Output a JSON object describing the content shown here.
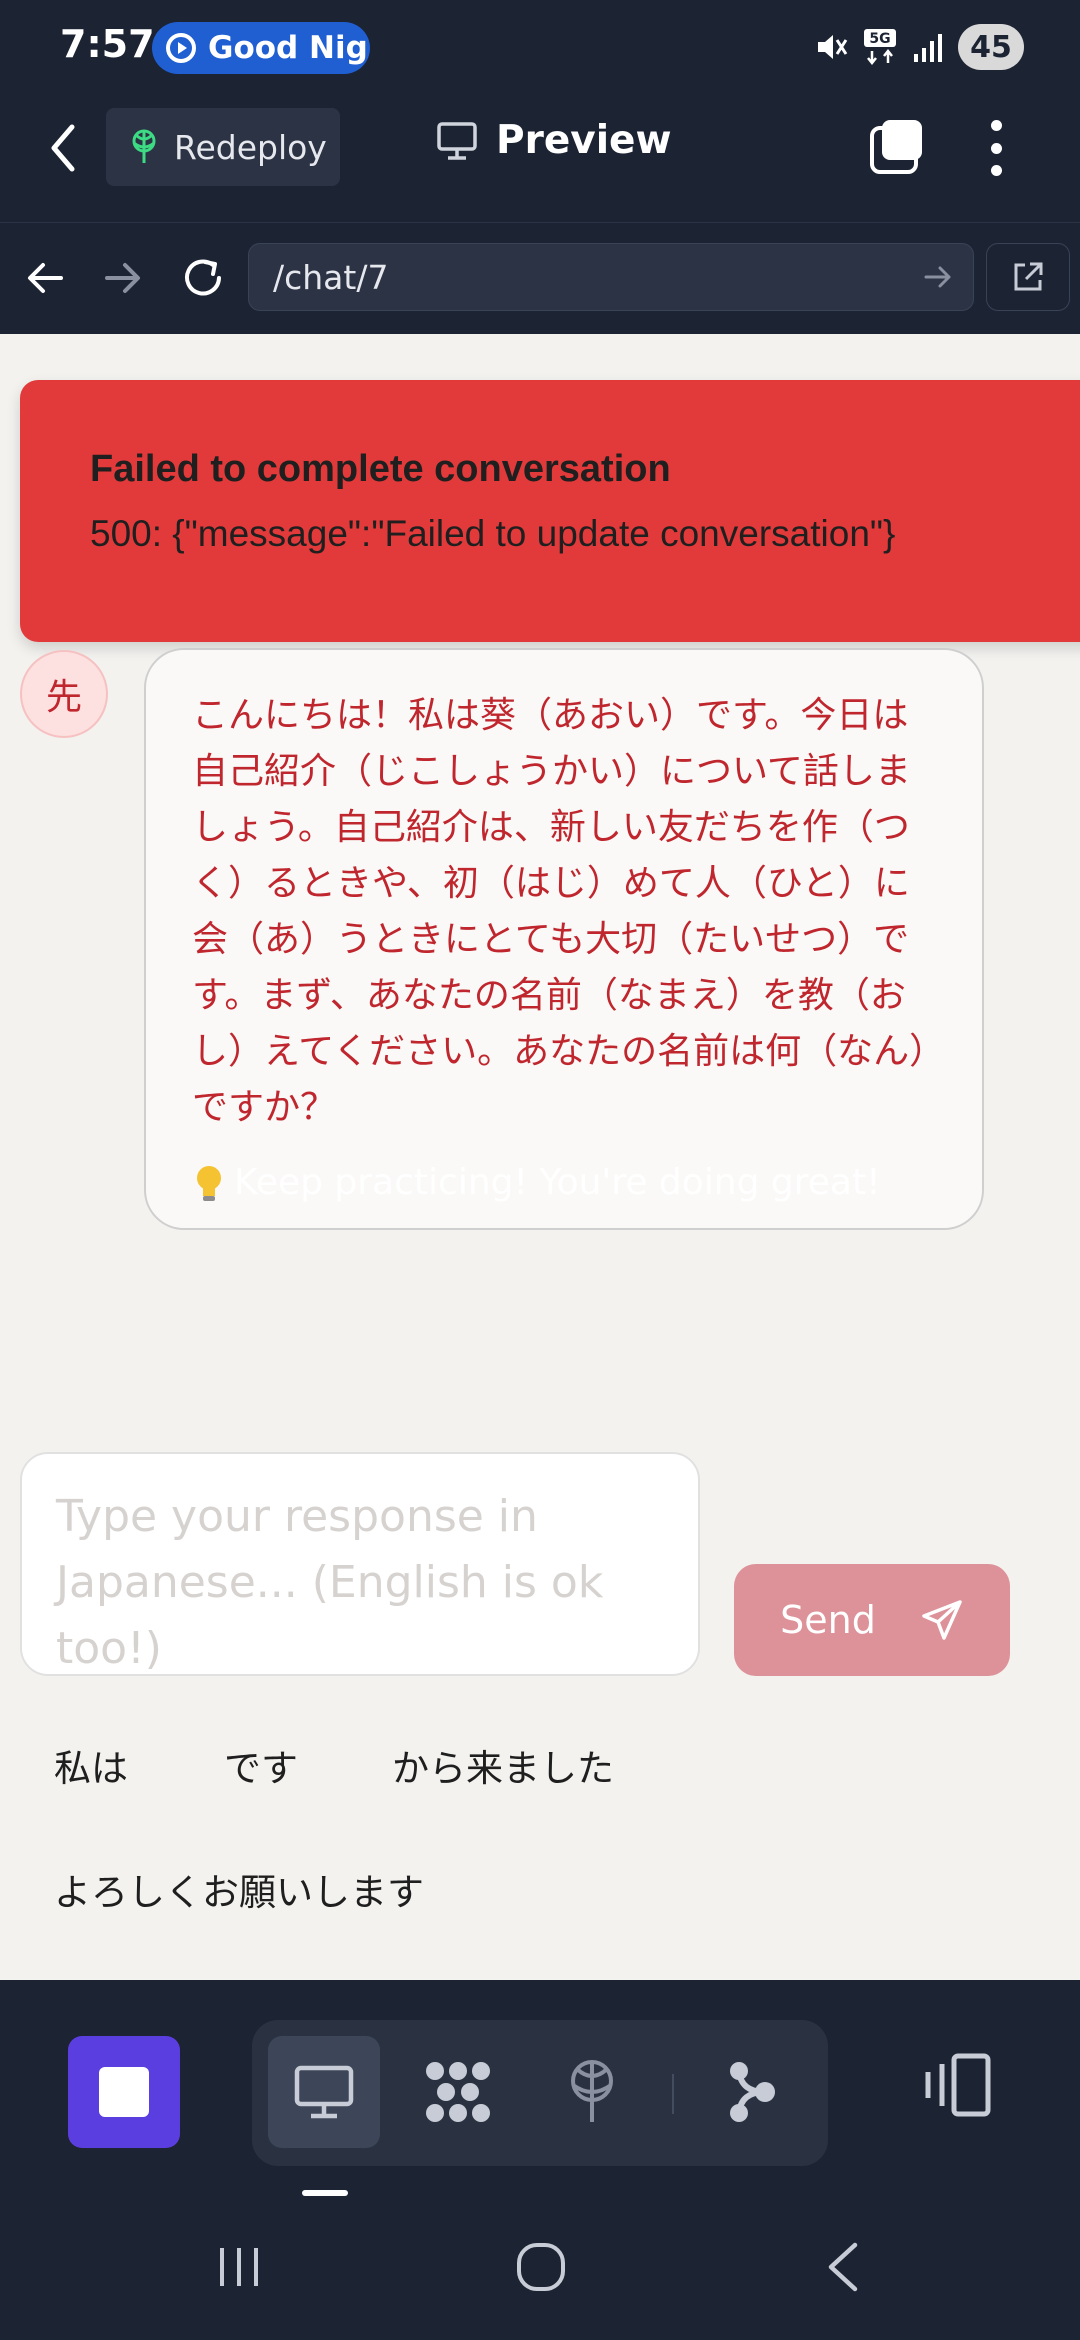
{
  "status_bar": {
    "time": "7:57",
    "notification_text": "Good Nig",
    "battery": "45",
    "network": "5G"
  },
  "header": {
    "redeploy_label": "Redeploy",
    "preview_label": "Preview"
  },
  "browser": {
    "url": "/chat/7"
  },
  "toast": {
    "title": "Failed to complete conversation",
    "message": "500: {\"message\":\"Failed to update conversation\"}"
  },
  "chat": {
    "avatar_label": "先",
    "message_text": "こんにちは！私は葵（あおい）です。今日は自己紹介（じこしょうかい）について話しましょう。自己紹介は、新しい友だちを作（つく）るときや、初（はじ）めて人（ひと）に会（あ）うときにとても大切（たいせつ）です。まず、あなたの名前（なまえ）を教（おし）えてください。あなたの名前は何（なん）ですか？",
    "tip_text": "Keep practicing! You're doing great!"
  },
  "composer": {
    "placeholder": "Type your response in Japanese... (English is ok too!)",
    "send_label": "Send"
  },
  "suggestions": [
    "私は",
    "です",
    "から来ました",
    "よろしくお願いします"
  ],
  "colors": {
    "app_bg": "#1c2333",
    "error_red": "#e23a3a",
    "message_red": "#c0262d",
    "send_pink": "#dd9198",
    "stop_purple": "#5b3ee0",
    "redeploy_green": "#3ddc84"
  }
}
